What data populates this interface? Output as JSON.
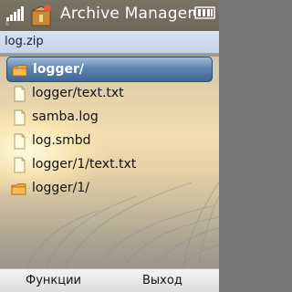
{
  "status_bar": {
    "title": "Archive Manager",
    "signal_icon": "signal-strength-icon",
    "battery_icon": "battery-icon",
    "app_icon": "archive-manager-icon"
  },
  "path": "log.zip",
  "files": [
    {
      "name": "logger/",
      "type": "folder",
      "selected": true
    },
    {
      "name": "logger/text.txt",
      "type": "file",
      "selected": false
    },
    {
      "name": "samba.log",
      "type": "file",
      "selected": false
    },
    {
      "name": "log.smbd",
      "type": "file",
      "selected": false
    },
    {
      "name": "logger/1/text.txt",
      "type": "file",
      "selected": false
    },
    {
      "name": "logger/1/",
      "type": "folder",
      "selected": false
    }
  ],
  "softkeys": {
    "left": "Функции",
    "right": "Выход"
  },
  "colors": {
    "selection": "#4f78a5",
    "path_bar": "#cddaea",
    "status_bar": "#737060"
  }
}
